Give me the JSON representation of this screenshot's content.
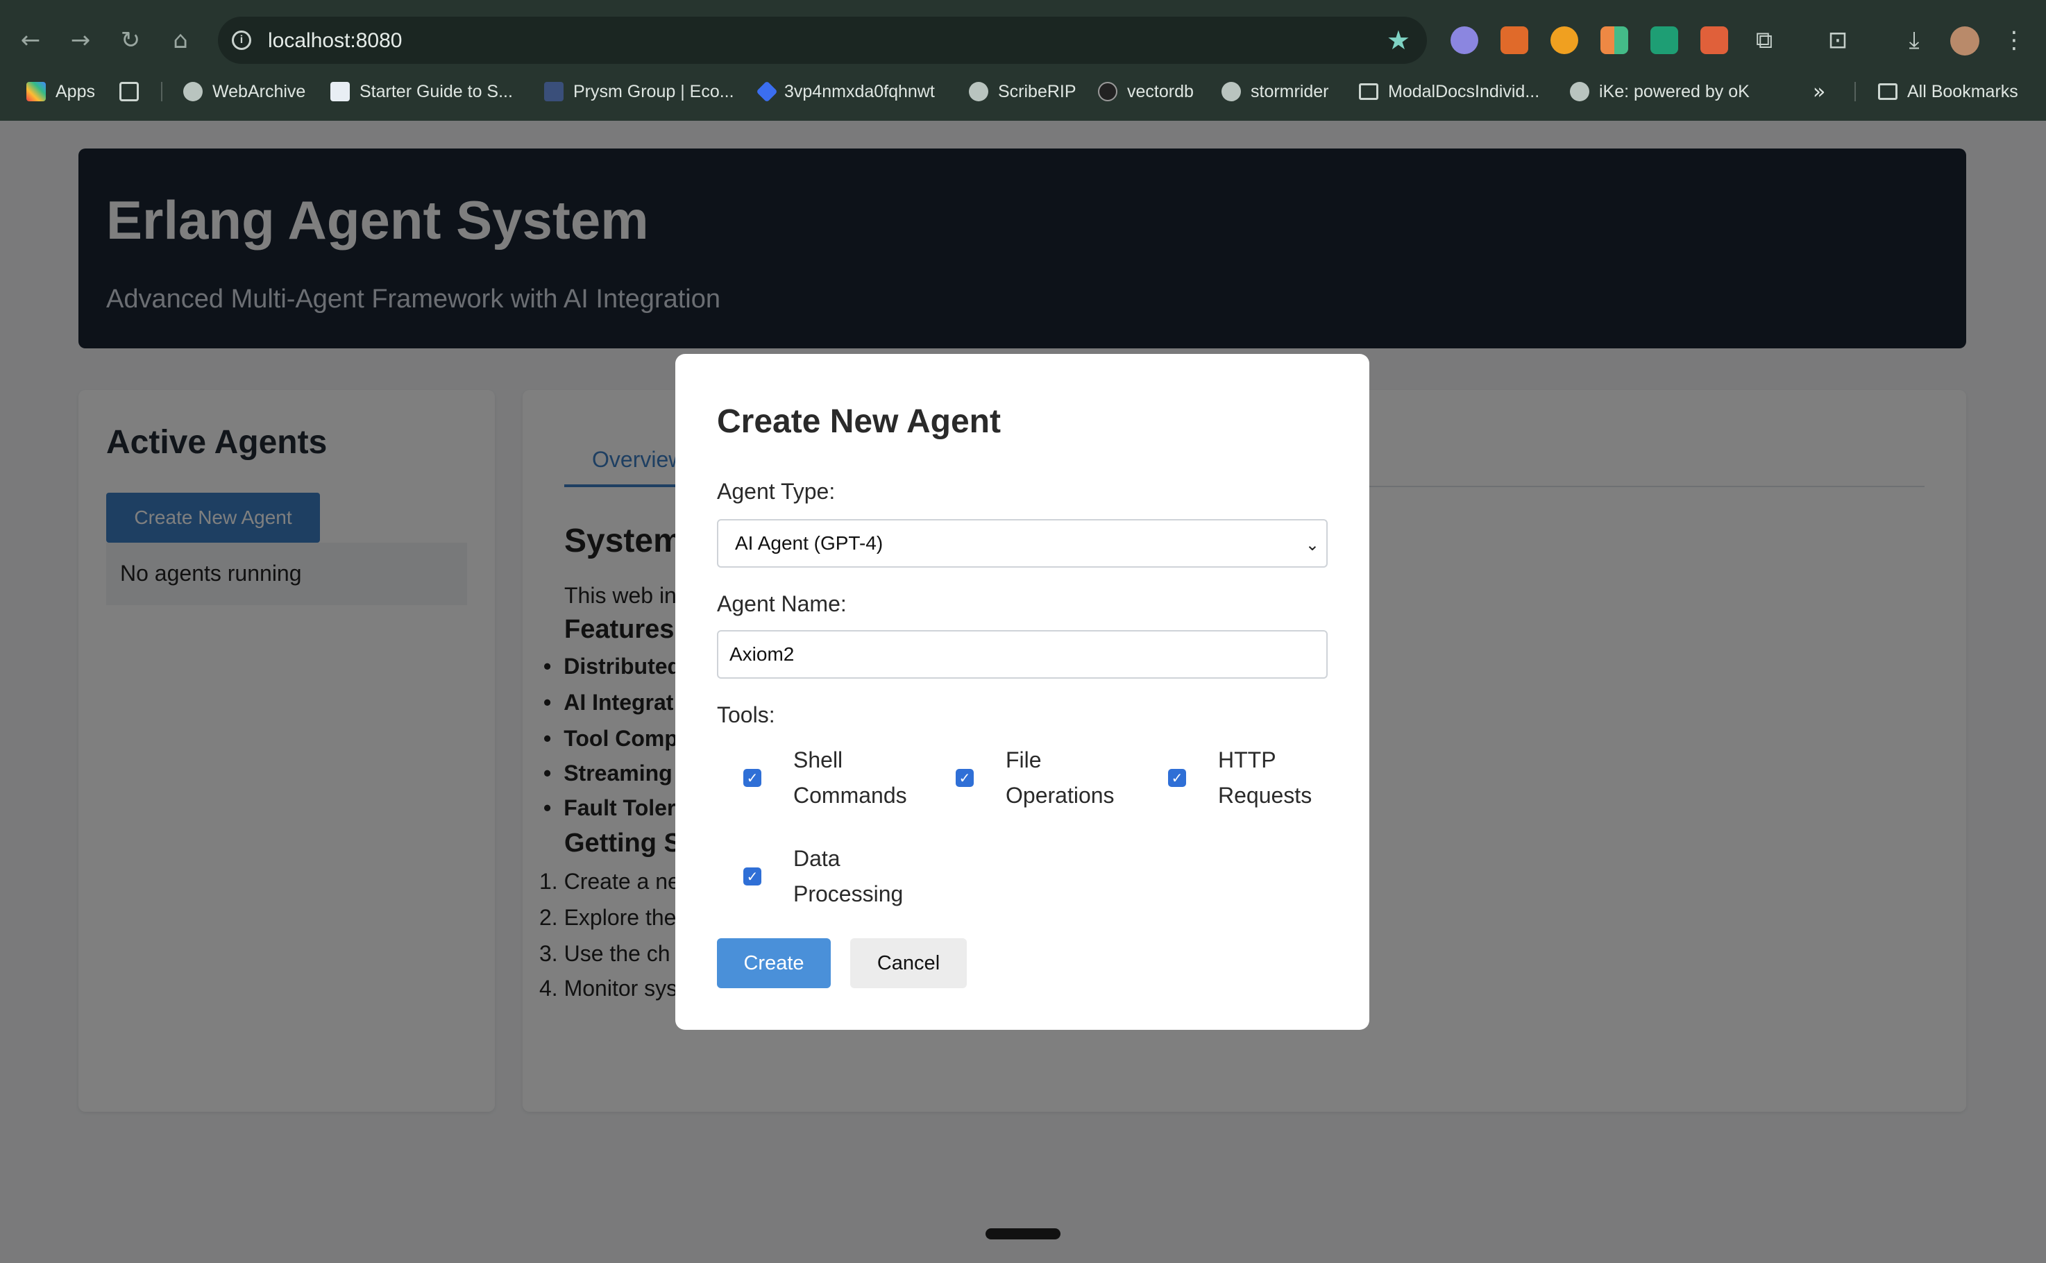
{
  "browser": {
    "url": "localhost:8080",
    "bookmarks": [
      {
        "label": "Apps",
        "icon": "apps-grid-icon"
      },
      {
        "label": "WebArchive",
        "icon": "globe-icon"
      },
      {
        "label": "Starter Guide to S...",
        "icon": "page-icon"
      },
      {
        "label": "Prysm Group | Eco...",
        "icon": "cube-icon"
      },
      {
        "label": "3vp4nmxda0fqhnwt",
        "icon": "diamond-icon"
      },
      {
        "label": "ScribeRIP",
        "icon": "globe-icon"
      },
      {
        "label": "vectordb",
        "icon": "github-icon"
      },
      {
        "label": "stormrider",
        "icon": "globe-icon"
      },
      {
        "label": "ModalDocsIndivid...",
        "icon": "folder-icon"
      },
      {
        "label": "iKe: powered by oK",
        "icon": "globe-icon"
      }
    ],
    "all_bookmarks": "All Bookmarks"
  },
  "app": {
    "title": "Erlang Agent System",
    "subtitle": "Advanced Multi-Agent Framework with AI Integration"
  },
  "sidebar": {
    "title": "Active Agents",
    "create_button": "Create New Agent",
    "empty_text": "No agents running"
  },
  "main": {
    "tab": "Overview",
    "heading": "System",
    "intro": "This web in",
    "features_heading": "Features",
    "features": [
      "Distributed",
      "AI Integrat",
      "Tool Comp",
      "Streaming",
      "Fault Toler"
    ],
    "getting_started_heading": "Getting S",
    "steps": [
      "1. Create a ne",
      "2. Explore the",
      "3. Use the ch",
      "4. Monitor sys"
    ]
  },
  "modal": {
    "title": "Create New Agent",
    "type_label": "Agent Type:",
    "type_value": "AI Agent (GPT-4)",
    "name_label": "Agent Name:",
    "name_value": "Axiom2",
    "tools_label": "Tools:",
    "tools": [
      {
        "line1": "Shell",
        "line2": "Commands",
        "checked": true
      },
      {
        "line1": "File",
        "line2": "Operations",
        "checked": true
      },
      {
        "line1": "HTTP",
        "line2": "Requests",
        "checked": true
      },
      {
        "line1": "Data",
        "line2": "Processing",
        "checked": true
      }
    ],
    "create_button": "Create",
    "cancel_button": "Cancel"
  },
  "colors": {
    "header_bg": "#1b2533",
    "primary": "#4a90d9",
    "checkbox": "#2f6fd6",
    "chrome_bg": "#27352f"
  }
}
